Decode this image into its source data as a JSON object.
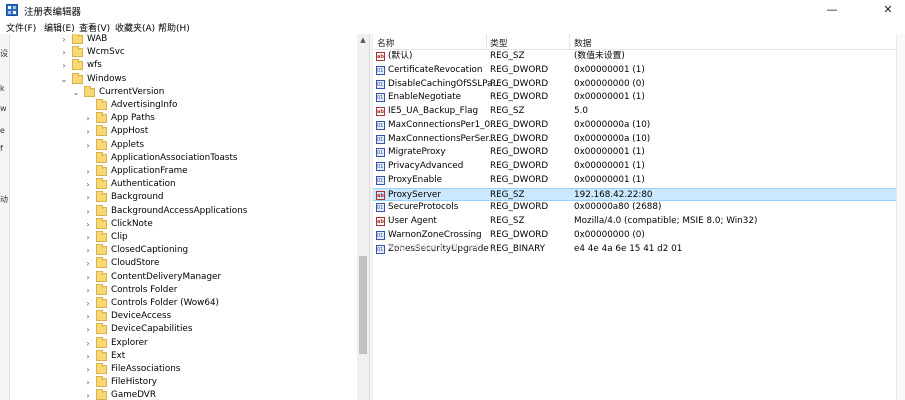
{
  "window": {
    "title": "注册表编辑器",
    "controls": {
      "minimize": "—",
      "close": "✕"
    }
  },
  "menu": [
    "文件(F)",
    "编辑(E)",
    "查看(V)",
    "收藏夹(A)",
    "帮助(H)"
  ],
  "left_strip": [
    "设",
    "k",
    "w",
    "e",
    "f",
    "动"
  ],
  "tree": [
    {
      "label": "WAB",
      "expander": "›",
      "folder_color": "#f8d775"
    },
    {
      "label": "WcmSvc",
      "expander": "›"
    },
    {
      "label": "wfs",
      "expander": "›"
    },
    {
      "label": "Windows",
      "expander": "⌄"
    },
    {
      "label": "CurrentVersion",
      "expander": "⌄"
    },
    {
      "label": "AdvertisingInfo",
      "expander": ""
    },
    {
      "label": "App Paths",
      "expander": "›"
    },
    {
      "label": "AppHost",
      "expander": "›"
    },
    {
      "label": "Applets",
      "expander": "›"
    },
    {
      "label": "ApplicationAssociationToasts",
      "expander": ""
    },
    {
      "label": "ApplicationFrame",
      "expander": "›"
    },
    {
      "label": "Authentication",
      "expander": "›"
    },
    {
      "label": "Background",
      "expander": "›"
    },
    {
      "label": "BackgroundAccessApplications",
      "expander": "›"
    },
    {
      "label": "ClickNote",
      "expander": "›"
    },
    {
      "label": "Clip",
      "expander": "›"
    },
    {
      "label": "ClosedCaptioning",
      "expander": "›"
    },
    {
      "label": "CloudStore",
      "expander": "›"
    },
    {
      "label": "ContentDeliveryManager",
      "expander": "›"
    },
    {
      "label": "Controls Folder",
      "expander": "›"
    },
    {
      "label": "Controls Folder (Wow64)",
      "expander": "›"
    },
    {
      "label": "DeviceAccess",
      "expander": "›"
    },
    {
      "label": "DeviceCapabilities",
      "expander": "›"
    },
    {
      "label": "Explorer",
      "expander": "›"
    },
    {
      "label": "Ext",
      "expander": "›"
    },
    {
      "label": "FileAssociations",
      "expander": "›"
    },
    {
      "label": "FileHistory",
      "expander": "›"
    },
    {
      "label": "GameDVR",
      "expander": "›"
    }
  ],
  "list": {
    "headers": [
      "名称",
      "类型",
      "数据"
    ],
    "rows": [
      {
        "icon": "ab",
        "kind": "sz",
        "name": "(默认)",
        "type": "REG_SZ",
        "data": "(数值未设置)",
        "selected": false
      },
      {
        "icon": "011",
        "kind": "bin",
        "name": "CertificateRevocation",
        "type": "REG_DWORD",
        "data": "0x00000001 (1)",
        "selected": false
      },
      {
        "icon": "011",
        "kind": "bin",
        "name": "DisableCachingOfSSLPa...",
        "type": "REG_DWORD",
        "data": "0x00000000 (0)",
        "selected": false
      },
      {
        "icon": "011",
        "kind": "bin",
        "name": "EnableNegotiate",
        "type": "REG_DWORD",
        "data": "0x00000001 (1)",
        "selected": false
      },
      {
        "icon": "ab",
        "kind": "sz",
        "name": "IE5_UA_Backup_Flag",
        "type": "REG_SZ",
        "data": "5.0",
        "selected": false
      },
      {
        "icon": "011",
        "kind": "bin",
        "name": "MaxConnectionsPer1_0...",
        "type": "REG_DWORD",
        "data": "0x0000000a (10)",
        "selected": false
      },
      {
        "icon": "011",
        "kind": "bin",
        "name": "MaxConnectionsPerSer...",
        "type": "REG_DWORD",
        "data": "0x0000000a (10)",
        "selected": false
      },
      {
        "icon": "011",
        "kind": "bin",
        "name": "MigrateProxy",
        "type": "REG_DWORD",
        "data": "0x00000001 (1)",
        "selected": false
      },
      {
        "icon": "011",
        "kind": "bin",
        "name": "PrivacyAdvanced",
        "type": "REG_DWORD",
        "data": "0x00000001 (1)",
        "selected": false
      },
      {
        "icon": "011",
        "kind": "bin",
        "name": "ProxyEnable",
        "type": "REG_DWORD",
        "data": "0x00000001 (1)",
        "selected": false
      },
      {
        "icon": "ab",
        "kind": "sz",
        "name": "ProxyServer",
        "type": "REG_SZ",
        "data": "192.168.42.22:80",
        "selected": true
      },
      {
        "icon": "011",
        "kind": "bin",
        "name": "SecureProtocols",
        "type": "REG_DWORD",
        "data": "0x00000a80 (2688)",
        "selected": false
      },
      {
        "icon": "ab",
        "kind": "sz",
        "name": "User Agent",
        "type": "REG_SZ",
        "data": "Mozilla/4.0 (compatible; MSIE 8.0; Win32)",
        "selected": false
      },
      {
        "icon": "011",
        "kind": "bin",
        "name": "WarnonZoneCrossing",
        "type": "REG_DWORD",
        "data": "0x00000000 (0)",
        "selected": false
      },
      {
        "icon": "011",
        "kind": "bin",
        "name": "ZonesSecurityUpgrade",
        "type": "REG_BINARY",
        "data": "e4 4e 4a 6e 15 41 d2 01",
        "selected": false
      }
    ]
  },
  "watermark": "http://blog.csdn.net/",
  "colors": {
    "selection": "#cce8ff",
    "folder": "#f8d775"
  }
}
